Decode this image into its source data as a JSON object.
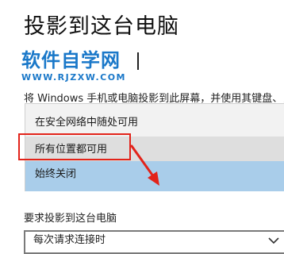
{
  "header": {
    "title": "投影到这台电脑"
  },
  "watermark": {
    "name": "软件自学网",
    "url": "WWW.RJZXW.COM"
  },
  "description": "将 Windows 手机或电脑投影到此屏幕，并使用其键盘、鼠标和其他设备",
  "dropdown": {
    "options": [
      {
        "label": "在安全网络中随处可用",
        "state": "normal"
      },
      {
        "label": "所有位置都可用",
        "state": "hover"
      },
      {
        "label": "始终关闭",
        "state": "selected"
      }
    ]
  },
  "pairing": {
    "label": "要求投影到这台电脑",
    "value": "每次请求连接时"
  },
  "colors": {
    "accent_selected": "#a9cdea",
    "hover": "#dedede",
    "annotation": "#e2231a",
    "watermark": "#1a78c9"
  }
}
